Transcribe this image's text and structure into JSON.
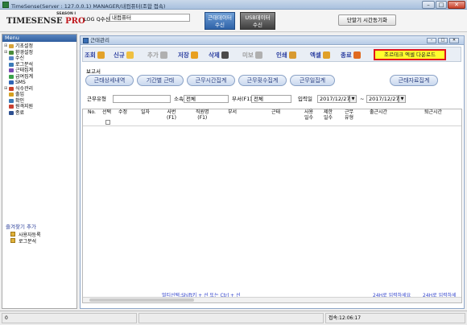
{
  "app": {
    "title": "TimeSense(Server : 127.0.0.1) MANAGER/내컴퓨터(조합 접속)",
    "window_buttons": [
      "–",
      "□",
      "✕"
    ]
  },
  "logo": {
    "season": "SEASON I",
    "brand": "TIMESENSE",
    "pro": "PRO"
  },
  "header": {
    "logq_label": "LOG Q수신",
    "logq_value": "내컴퓨터",
    "attendance_btn": [
      "근태데이터",
      "수신"
    ],
    "usb_btn": [
      "USB데이터",
      "수신"
    ],
    "sync_btn": "단말기 시간동기화"
  },
  "menu": {
    "header": "Menu",
    "items": [
      {
        "label": "기초설정",
        "icon": "folder-icon",
        "expand": "⊞",
        "color": "#d8a33a"
      },
      {
        "label": "환경설정",
        "icon": "settings-folder-icon",
        "expand": "⊞",
        "color": "#4a8c3a"
      },
      {
        "label": "수신",
        "icon": "receive-icon",
        "expand": "",
        "color": "#5b87c9"
      },
      {
        "label": "로그분석",
        "icon": "log-analysis-icon",
        "expand": "",
        "color": "#3a7ab8"
      },
      {
        "label": "근태집계",
        "icon": "attendance-summary-icon",
        "expand": "",
        "color": "#7a4ab3"
      },
      {
        "label": "급여집계",
        "icon": "payroll-summary-icon",
        "expand": "",
        "color": "#3aa14a"
      },
      {
        "label": "SMS",
        "icon": "sms-icon",
        "expand": "",
        "color": "#2f65b6"
      },
      {
        "label": "식수관리",
        "icon": "meal-management-icon",
        "expand": "⊞",
        "color": "#c9402a"
      },
      {
        "label": "출입",
        "icon": "access-icon",
        "expand": "",
        "color": "#d5a020"
      },
      {
        "label": "확인",
        "icon": "check-icon",
        "expand": "",
        "color": "#3a7ab8"
      },
      {
        "label": "원격지원",
        "icon": "remote-support-icon",
        "expand": "",
        "color": "#c94030"
      },
      {
        "label": "종료",
        "icon": "exit-icon",
        "expand": "",
        "color": "#2c4f90"
      }
    ]
  },
  "favorites": {
    "header": "즐겨찾기 추가",
    "items": [
      "사용자등록",
      "로그분석"
    ]
  },
  "subwindow": {
    "title": "근태관리",
    "buttons": [
      "–",
      "□",
      "✕"
    ]
  },
  "toolbar": {
    "buttons": [
      {
        "label": "조회",
        "icon": "search-icon",
        "enabled": true,
        "color": "#e3a22a"
      },
      {
        "label": "신규",
        "icon": "new-icon",
        "enabled": true,
        "color": "#f0c040"
      },
      {
        "label": "추가",
        "icon": "add-icon",
        "enabled": false,
        "color": "#b0b0b0"
      },
      {
        "label": "저장",
        "icon": "save-icon",
        "enabled": true,
        "color": "#e8a020"
      },
      {
        "label": "삭제",
        "icon": "delete-icon",
        "enabled": true,
        "color": "#4a4a4a"
      },
      {
        "label": "미보",
        "icon": "preview-icon",
        "enabled": false,
        "color": "#b0b0b0"
      },
      {
        "label": "인쇄",
        "icon": "print-icon",
        "enabled": true,
        "color": "#d89a30"
      },
      {
        "label": "엑셀",
        "icon": "excel-icon",
        "enabled": true,
        "color": "#e0a028"
      },
      {
        "label": "종료",
        "icon": "exit-icon",
        "enabled": true,
        "color": "#e06a20"
      }
    ],
    "excel_download": "조르테크 엑셀 다운로드"
  },
  "reports": {
    "label": "보고서",
    "buttons": [
      "근태상세내역",
      "기간별 근태",
      "근무시간집계",
      "근무횟수집계",
      "근무일집계",
      "근태자료집계"
    ]
  },
  "filters": {
    "work_type_label": "근무유형",
    "work_type_value": "",
    "dept_label": "소속",
    "dept_value": "전체",
    "sub_dept_label": "부서(F1)",
    "sub_dept_value": "전체",
    "date_label": "입력일",
    "date_from": "2017/12/27",
    "date_sep": "~",
    "date_to": "2017/12/27"
  },
  "grid": {
    "columns": [
      "No.",
      "선택",
      "수정",
      "일자",
      "사번\n(F1)",
      "직원명\n(F1)",
      "부서",
      "근태",
      "사용\n일수",
      "제한\n일수",
      "근무\n유형",
      "출근시간",
      "퇴근시간"
    ],
    "footer_hint": "멀티선택:Shift키 + 선 또는 Ctrl + 선",
    "footer_right1": "24H로 입력하세요",
    "footer_right2": "24H로 입력하세"
  },
  "status": {
    "left": "0",
    "time": "접속:12:06:17"
  }
}
